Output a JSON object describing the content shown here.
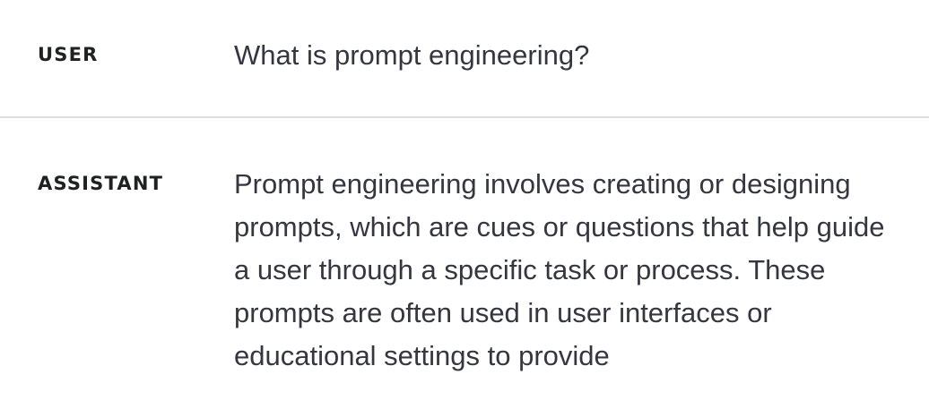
{
  "messages": {
    "user": {
      "role": "USER",
      "text": "What is prompt engineering?"
    },
    "assistant": {
      "role": "ASSISTANT",
      "text": "Prompt engineering involves creating or designing prompts, which are cues or questions that help guide a user through a specific task or process. These prompts are often used in user interfaces or educational settings to provide"
    }
  },
  "colors": {
    "text": "#353740",
    "role_label": "#202123",
    "divider": "#dcdcde",
    "background": "#ffffff"
  }
}
